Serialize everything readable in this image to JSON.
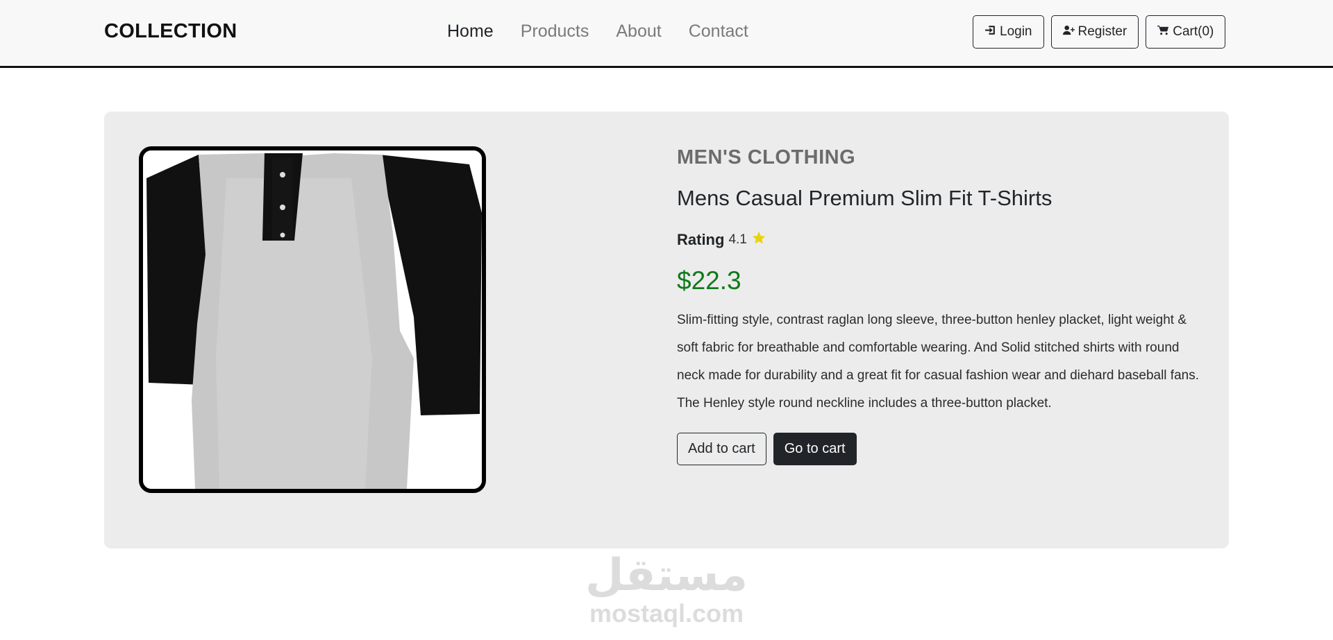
{
  "navbar": {
    "brand": "COLLECTION",
    "links": [
      {
        "label": "Home",
        "active": true
      },
      {
        "label": "Products",
        "active": false
      },
      {
        "label": "About",
        "active": false
      },
      {
        "label": "Contact",
        "active": false
      }
    ],
    "buttons": {
      "login": {
        "label": "Login",
        "icon": "sign-in-icon"
      },
      "register": {
        "label": "Register",
        "icon": "user-plus-icon"
      },
      "cart": {
        "label": "Cart(0)",
        "icon": "shopping-cart-icon"
      }
    }
  },
  "product": {
    "category": "men's clothing",
    "title": "Mens Casual Premium Slim Fit T-Shirts",
    "rating_label": "Rating",
    "rating_value": "4.1",
    "rating_icon": "star-icon",
    "price": "$22.3",
    "description": "Slim-fitting style, contrast raglan long sleeve, three-button henley placket, light weight & soft fabric for breathable and comfortable wearing. And Solid stitched shirts with round neck made for durability and a great fit for casual fashion wear and diehard baseball fans. The Henley style round neckline includes a three-button placket.",
    "add_to_cart_label": "Add to cart",
    "go_to_cart_label": "Go to cart"
  },
  "watermark": {
    "arabic": "مستقل",
    "latin": "mostaql.com"
  },
  "colors": {
    "price": "#0f7a1a",
    "star": "#e6d50a",
    "card_background": "#ececec",
    "dark": "#212529"
  }
}
